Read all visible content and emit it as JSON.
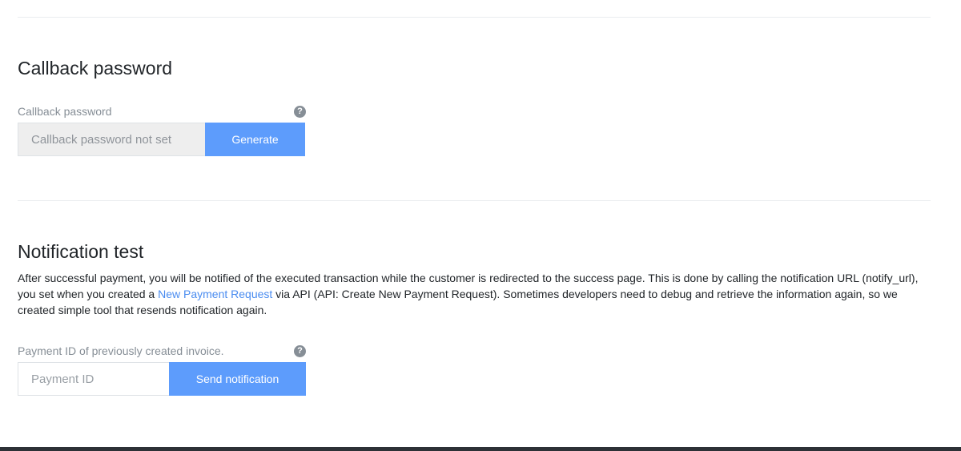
{
  "callback_section": {
    "title": "Callback password",
    "field_label": "Callback password",
    "help_icon_glyph": "?",
    "input_placeholder": "Callback password not set",
    "generate_label": "Generate"
  },
  "notification_section": {
    "title": "Notification test",
    "description_before_link": "After successful payment, you will be notified of the executed transaction while the customer is redirected to the success page. This is done by calling the notification URL (notify_url), you set when you created a ",
    "description_link": "New Payment Request",
    "description_after_link": " via API (API: Create New Payment Request). Sometimes developers need to debug and retrieve the information again, so we created simple tool that resends notification again.",
    "field_label": "Payment ID of previously created invoice.",
    "help_icon_glyph": "?",
    "input_placeholder": "Payment ID",
    "send_label": "Send notification"
  },
  "colors": {
    "primary_button": "#5d9cfc",
    "link": "#4a8cf0",
    "footer": "#2d3136"
  },
  "icons": {
    "help": "question-circle-icon"
  }
}
